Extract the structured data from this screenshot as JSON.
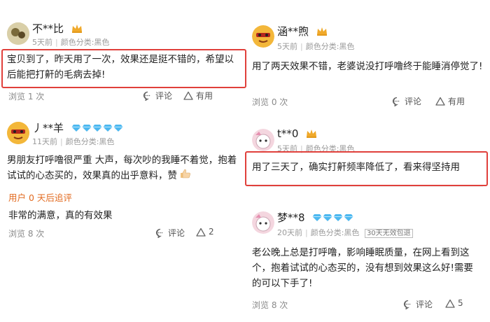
{
  "reviews": [
    {
      "username": "不**比",
      "time": "5天前",
      "color_label": "颜色分类:黑色",
      "body": "宝贝到了，昨天用了一次，效果还是挺不错的，希望以后能把打鼾的毛病去掉!",
      "views": "浏览 1 次",
      "comment": "评论",
      "useful": "有用"
    },
    {
      "username": "丿**羊",
      "time": "11天前",
      "color_label": "颜色分类:黑色",
      "body": "男朋友打呼噜很严重 大声，每次吵的我睡不着觉，抱着试试的心态买的，效果真的出乎意料，赞",
      "additional_label": "用户 0 天后追评",
      "additional_body": "非常的满意，真的有效果",
      "views": "浏览 8 次",
      "comment": "评论",
      "useful": "2"
    },
    {
      "username": "涵**煦",
      "time": "5天前",
      "color_label": "颜色分类:黑色",
      "body": "用了两天效果不错，老婆说没打呼噜终于能睡消停觉了!",
      "views": "浏览 0 次",
      "comment": "评论",
      "useful": "有用"
    },
    {
      "username": "t**0",
      "time": "5天前",
      "color_label": "颜色分类:黑色",
      "body": "用了三天了，确实打鼾频率降低了，看来得坚持用"
    },
    {
      "username": "梦**8",
      "time": "20天前",
      "color_label": "颜色分类:黑色",
      "tag": "30天无效包退",
      "body": "老公晚上总是打呼噜，影响睡眠质量，在网上看到这个，抱着试试的心态买的，没有想到效果这么好!需要的可以下手了!",
      "views": "浏览 8 次",
      "comment": "评论",
      "useful": "5"
    }
  ],
  "icons": {
    "comment": "comment-bubble-icon",
    "useful": "triangle-up-icon",
    "badge_crown": "crown-badge-icon",
    "badge_diamond": "diamond-badge-icon"
  },
  "colors": {
    "highlight_border": "#e0403b",
    "followup_label": "#e26a1f",
    "crown": "#f0a92a",
    "diamond": "#4cb8f0"
  }
}
